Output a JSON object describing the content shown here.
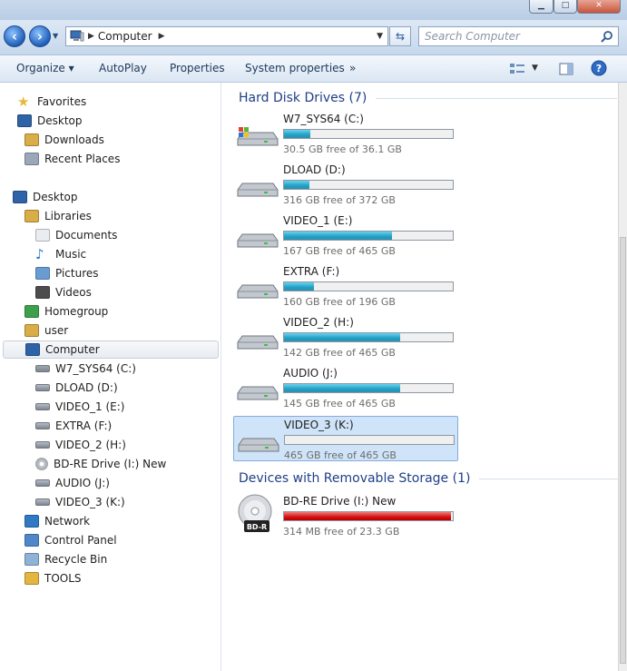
{
  "window": {
    "minimize": "▁",
    "maximize": "□",
    "close": "✕"
  },
  "nav": {
    "back_icon": "back-arrow-icon",
    "forward_icon": "forward-arrow-icon",
    "address_path": "Computer",
    "search_placeholder": "Search Computer"
  },
  "toolbar": {
    "organize": "Organize ▾",
    "autoplay": "AutoPlay",
    "properties": "Properties",
    "system_properties": "System properties",
    "more": "»"
  },
  "sidebar": {
    "items": [
      {
        "label": "Favorites",
        "icon": "star-icon"
      },
      {
        "label": "Desktop",
        "icon": "desktop-icon"
      },
      {
        "label": "Downloads",
        "icon": "downloads-icon"
      },
      {
        "label": "Recent Places",
        "icon": "recent-places-icon"
      },
      {
        "label": "Desktop",
        "icon": "desktop-icon"
      },
      {
        "label": "Libraries",
        "icon": "libraries-icon"
      },
      {
        "label": "Documents",
        "icon": "documents-icon"
      },
      {
        "label": "Music",
        "icon": "music-icon"
      },
      {
        "label": "Pictures",
        "icon": "pictures-icon"
      },
      {
        "label": "Videos",
        "icon": "videos-icon"
      },
      {
        "label": "Homegroup",
        "icon": "homegroup-icon"
      },
      {
        "label": "user",
        "icon": "user-folder-icon"
      },
      {
        "label": "Computer",
        "icon": "computer-icon"
      },
      {
        "label": "W7_SYS64 (C:)",
        "icon": "system-drive-icon"
      },
      {
        "label": "DLOAD (D:)",
        "icon": "drive-icon"
      },
      {
        "label": "VIDEO_1 (E:)",
        "icon": "drive-icon"
      },
      {
        "label": "EXTRA (F:)",
        "icon": "drive-icon"
      },
      {
        "label": "VIDEO_2 (H:)",
        "icon": "drive-icon"
      },
      {
        "label": "BD-RE Drive (I:) New",
        "icon": "disc-icon"
      },
      {
        "label": "AUDIO (J:)",
        "icon": "drive-icon"
      },
      {
        "label": "VIDEO_3 (K:)",
        "icon": "drive-icon"
      },
      {
        "label": "Network",
        "icon": "network-icon"
      },
      {
        "label": "Control Panel",
        "icon": "control-panel-icon"
      },
      {
        "label": "Recycle Bin",
        "icon": "recycle-bin-icon"
      },
      {
        "label": "TOOLS",
        "icon": "folder-icon"
      }
    ]
  },
  "content": {
    "hdd_group": "Hard Disk Drives (7)",
    "removable_group": "Devices with Removable Storage (1)",
    "drives": [
      {
        "name": "W7_SYS64 (C:)",
        "free": "30.5 GB free of 36.1 GB",
        "used_fraction": 0.155
      },
      {
        "name": "DLOAD (D:)",
        "free": "316 GB free of 372 GB",
        "used_fraction": 0.15
      },
      {
        "name": "VIDEO_1 (E:)",
        "free": "167 GB free of 465 GB",
        "used_fraction": 0.64
      },
      {
        "name": "EXTRA (F:)",
        "free": "160 GB free of 196 GB",
        "used_fraction": 0.18
      },
      {
        "name": "VIDEO_2 (H:)",
        "free": "142 GB free of 465 GB",
        "used_fraction": 0.69
      },
      {
        "name": "AUDIO (J:)",
        "free": "145 GB free of 465 GB",
        "used_fraction": 0.69
      },
      {
        "name": "VIDEO_3 (K:)",
        "free": "465 GB free of 465 GB",
        "used_fraction": 0.0
      }
    ],
    "removable": {
      "name": "BD-RE Drive (I:) New",
      "free": "314 MB free of 23.3 GB",
      "used_fraction": 0.987,
      "disc_label": "BD-R"
    }
  },
  "colors": {
    "bar_normal": "#1fa0c5",
    "bar_full": "#d80f0f",
    "group_header": "#1e3f87"
  }
}
